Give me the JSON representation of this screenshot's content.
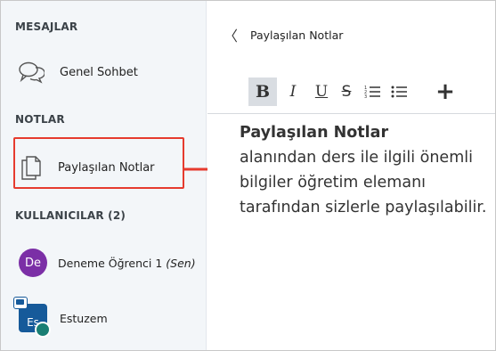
{
  "sidebar": {
    "messages_title": "MESAJLAR",
    "chat_label": "Genel Sohbet",
    "notes_title": "NOTLAR",
    "notes_label": "Paylaşılan Notlar",
    "users_title": "KULLANICILAR (2)",
    "users": [
      {
        "initials": "De",
        "name": "Deneme Öğrenci 1",
        "tag": "(Sen)",
        "avatar_color": "#7b2fa6"
      },
      {
        "initials": "Es",
        "name": "Estuzem",
        "avatar_color": "#165a9a"
      }
    ]
  },
  "main": {
    "back_icon": "chevron-left",
    "title": "Paylaşılan Notlar",
    "toolbar": {
      "bold": "B",
      "italic": "I",
      "underline": "U",
      "strike": "S",
      "ordered_list": "☰",
      "bullet_list": "☰",
      "insert": "+"
    },
    "content_bold": "Paylaşılan Notlar",
    "content_text": "alanından ders ile ilgili önemli bilgiler öğretim elemanı tarafından sizlerle paylaşılabilir."
  },
  "annotation": {
    "highlight_color": "#e63b2e"
  }
}
